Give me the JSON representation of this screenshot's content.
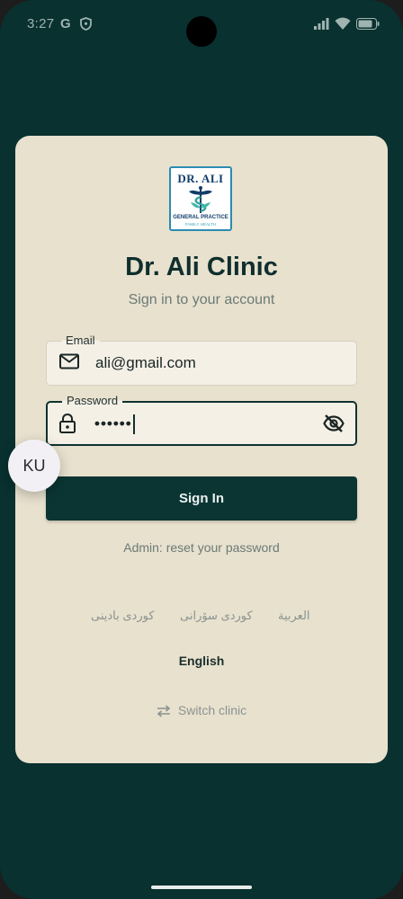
{
  "status_bar": {
    "time": "3:27",
    "g_label": "G"
  },
  "app": {
    "logo": {
      "name_text": "DR. ALI",
      "subtitle": "GENERAL PRACTICE",
      "tagline": "FAMILY HEALTH"
    },
    "title": "Dr. Ali Clinic",
    "subtitle": "Sign in to your account"
  },
  "form": {
    "email": {
      "label": "Email",
      "value": "ali@gmail.com"
    },
    "password": {
      "label": "Password",
      "value": "••••••"
    },
    "sign_in_label": "Sign In",
    "reset_link": "Admin: reset your password"
  },
  "language_bubble": "KU",
  "languages": {
    "badini": "كوردی بادینی",
    "sorani": "کوردی سۆرانی",
    "arabic": "العربية",
    "english": "English"
  },
  "switch_clinic": "Switch clinic",
  "colors": {
    "background": "#08312f",
    "card": "#e8e1ce",
    "primary_button": "#0b3533"
  },
  "icons": [
    "email-icon",
    "lock-icon",
    "eye-off-icon",
    "swap-icon",
    "wifi-icon",
    "signal-icon",
    "battery-icon"
  ]
}
